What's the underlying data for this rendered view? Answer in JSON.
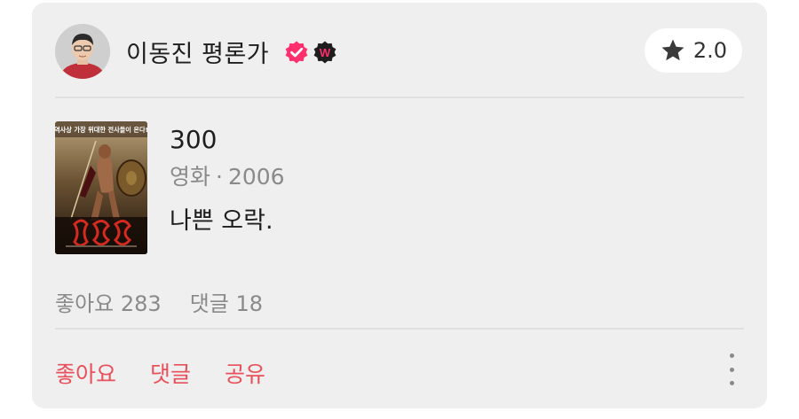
{
  "author": {
    "name": "이동진 평론가",
    "verified_icon": "verified-check-icon",
    "badge_icon": "w-badge-icon",
    "badge_letter": "W"
  },
  "rating": {
    "icon": "star-icon",
    "value": "2.0"
  },
  "movie": {
    "title": "300",
    "category": "영화",
    "separator": "·",
    "year": "2006",
    "poster_tagline": "역사상 가장 위대한 전사들이 온다!"
  },
  "review": {
    "text": "나쁜 오락."
  },
  "stats": {
    "likes": "좋아요 283",
    "comments": "댓글 18"
  },
  "actions": {
    "like": "좋아요",
    "comment": "댓글",
    "share": "공유"
  },
  "colors": {
    "card_bg": "#efefef",
    "accent": "#e8505b",
    "verified": "#ff2f6e",
    "muted_text": "#8a8a8a"
  }
}
